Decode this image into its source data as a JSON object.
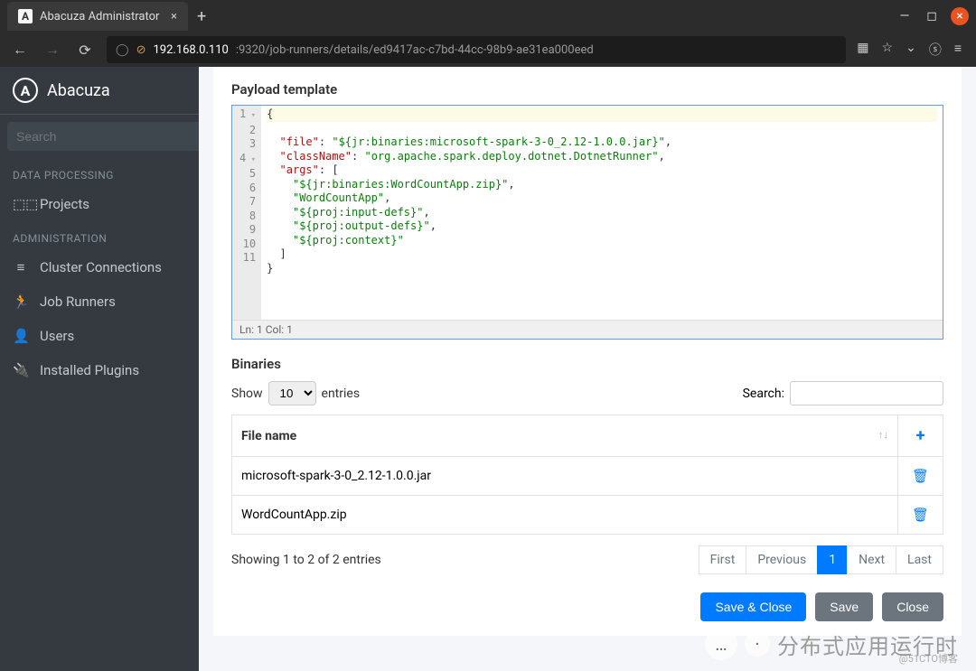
{
  "browser": {
    "tab_title": "Abacuza Administrator",
    "url_host": "192.168.0.110",
    "url_path": ":9320/job-runners/details/ed9417ac-c7bd-44cc-98b9-ae31ea000eed"
  },
  "brand": {
    "name": "Abacuza",
    "logo_letter": "A"
  },
  "sidebar": {
    "search_placeholder": "Search",
    "sections": [
      {
        "header": "DATA PROCESSING",
        "items": [
          {
            "label": "Projects",
            "icon": "projects"
          }
        ]
      },
      {
        "header": "ADMINISTRATION",
        "items": [
          {
            "label": "Cluster Connections",
            "icon": "cluster"
          },
          {
            "label": "Job Runners",
            "icon": "runner"
          },
          {
            "label": "Users",
            "icon": "user"
          },
          {
            "label": "Installed Plugins",
            "icon": "plug"
          }
        ]
      }
    ]
  },
  "payload": {
    "title": "Payload template",
    "status": "Ln: 1   Col: 1",
    "lines": [
      {
        "n": 1,
        "fold": true,
        "html": "<span class='t-brace'>{</span>",
        "hl": true
      },
      {
        "n": 2,
        "fold": false,
        "html": "  <span class='t-key'>\"file\"</span><span class='t-punc'>: </span><span class='t-str'>\"${jr:binaries:microsoft-spark-3-0_2.12-1.0.0.jar}\"</span><span class='t-punc'>,</span>"
      },
      {
        "n": 3,
        "fold": false,
        "html": "  <span class='t-key'>\"className\"</span><span class='t-punc'>: </span><span class='t-str'>\"org.apache.spark.deploy.dotnet.DotnetRunner\"</span><span class='t-punc'>,</span>"
      },
      {
        "n": 4,
        "fold": true,
        "html": "  <span class='t-key'>\"args\"</span><span class='t-punc'>: [</span>"
      },
      {
        "n": 5,
        "fold": false,
        "html": "    <span class='t-str'>\"${jr:binaries:WordCountApp.zip}\"</span><span class='t-punc'>,</span>"
      },
      {
        "n": 6,
        "fold": false,
        "html": "    <span class='t-str'>\"WordCountApp\"</span><span class='t-punc'>,</span>"
      },
      {
        "n": 7,
        "fold": false,
        "html": "    <span class='t-str'>\"${proj:input-defs}\"</span><span class='t-punc'>,</span>"
      },
      {
        "n": 8,
        "fold": false,
        "html": "    <span class='t-str'>\"${proj:output-defs}\"</span><span class='t-punc'>,</span>"
      },
      {
        "n": 9,
        "fold": false,
        "html": "    <span class='t-str'>\"${proj:context}\"</span>"
      },
      {
        "n": 10,
        "fold": false,
        "html": "  <span class='t-punc'>]</span>"
      },
      {
        "n": 11,
        "fold": false,
        "html": "<span class='t-brace'>}</span>"
      }
    ]
  },
  "binaries": {
    "title": "Binaries",
    "show_label": "Show",
    "entries_label": "entries",
    "page_size": "10",
    "search_label": "Search:",
    "search_value": "",
    "col_filename": "File name",
    "rows": [
      {
        "name": "microsoft-spark-3-0_2.12-1.0.0.jar"
      },
      {
        "name": "WordCountApp.zip"
      }
    ],
    "info": "Showing 1 to 2 of 2 entries",
    "pagination": {
      "first": "First",
      "previous": "Previous",
      "page": "1",
      "next": "Next",
      "last": "Last"
    }
  },
  "footer": {
    "save_close": "Save & Close",
    "save": "Save",
    "close": "Close"
  },
  "overlay": {
    "text": "分布式应用运行时",
    "watermark": "@51CTO博客"
  }
}
